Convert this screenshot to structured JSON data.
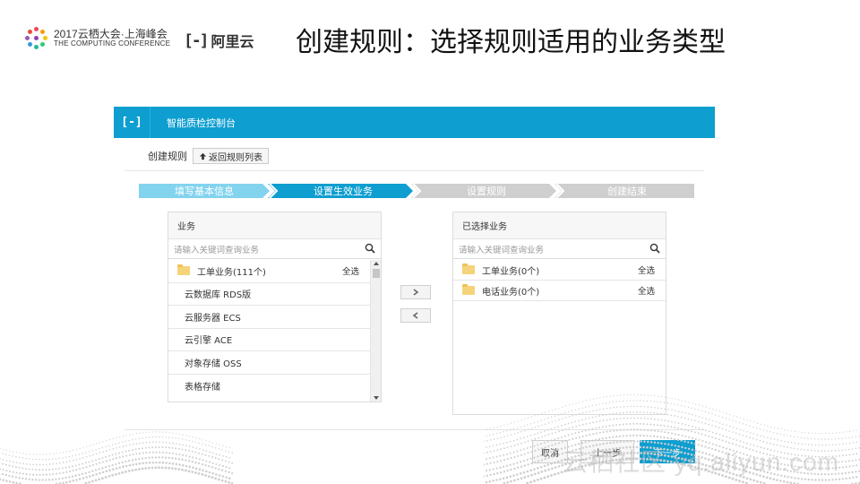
{
  "branding": {
    "conference_line1": "2017云栖大会·上海峰会",
    "conference_line2": "THE COMPUTING CONFERENCE",
    "aliyun_logo": "[-]",
    "aliyun_name": "阿里云"
  },
  "slide_title": "创建规则：选择规则适用的业务类型",
  "console": {
    "logo": "[-]",
    "title": "智能质检控制台",
    "page_label": "创建规则",
    "back_button": "返回规则列表",
    "steps": [
      {
        "label": "填写基本信息",
        "state": "done"
      },
      {
        "label": "设置生效业务",
        "state": "active"
      },
      {
        "label": "设置规则",
        "state": "todo"
      },
      {
        "label": "创建结束",
        "state": "todo"
      }
    ],
    "left_panel": {
      "header": "业务",
      "search_placeholder": "请输入关键词查询业务",
      "group": {
        "label": "工单业务(111个)",
        "select_all": "全选"
      },
      "items": [
        "云数据库 RDS版",
        "云服务器 ECS",
        "云引擎 ACE",
        "对象存储 OSS",
        "表格存储"
      ]
    },
    "right_panel": {
      "header": "已选择业务",
      "search_placeholder": "请输入关键词查询业务",
      "groups": [
        {
          "label": "工单业务(0个)",
          "select_all": "全选"
        },
        {
          "label": "电话业务(0个)",
          "select_all": "全选"
        }
      ]
    },
    "buttons": {
      "cancel": "取消",
      "prev": "上一步",
      "next": "下一步"
    }
  },
  "watermark": "云栖社区 yq.aliyun.com",
  "colors": {
    "primary": "#0e9ed0",
    "step_done": "#82d3ee",
    "step_active": "#0e9ed0",
    "step_todo": "#cfcfcf",
    "folder": "#f5d37b"
  }
}
